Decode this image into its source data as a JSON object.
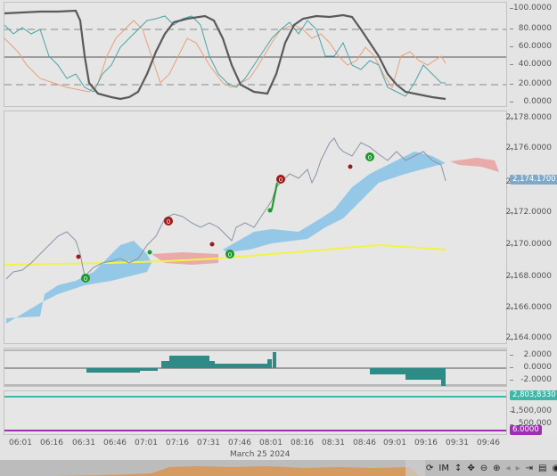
{
  "oscillator_pane": {
    "y_ticks": [
      "100.0000",
      "80.0000",
      "60.0000",
      "40.0000",
      "20.0000",
      "0.0000"
    ]
  },
  "price_pane": {
    "y_ticks": [
      "2,178.0000",
      "2,176.0000",
      "2,174.0000",
      "2,172.0000",
      "2,170.0000",
      "2,168.0000",
      "2,166.0000",
      "2,164.0000"
    ],
    "last_price_badge": "2,174.1700",
    "signal_markers": [
      {
        "label": "0",
        "kind": "sell"
      },
      {
        "label": "0",
        "kind": "sell"
      },
      {
        "label": "0",
        "kind": "buy"
      },
      {
        "label": "0",
        "kind": "buy"
      },
      {
        "label": "0",
        "kind": "buy"
      }
    ]
  },
  "histogram_pane": {
    "y_ticks": [
      "2.0000",
      "0.0000",
      "-2.0000"
    ]
  },
  "volume_pane": {
    "y_ticks": [
      "1,500,000",
      "500,000"
    ],
    "top_badge": "2,803,8330",
    "bottom_badge": "6.0000"
  },
  "x_axis": {
    "labels": [
      "06:01",
      "06:16",
      "06:31",
      "06:46",
      "07:01",
      "07:16",
      "07:31",
      "07:46",
      "08:01",
      "08:16",
      "08:31",
      "08:46",
      "09:01",
      "09:16",
      "09:31",
      "09:46"
    ],
    "date": "March 25 2024"
  },
  "toolbar": {
    "im_label": "IM"
  },
  "colors": {
    "cloud_bull": "#8cc4e6",
    "cloud_bear": "#e9a3a3",
    "ma_line": "#f2f24a",
    "hist": "#2e8b86",
    "teal": "#3cb8a8",
    "purple": "#9d2fb0"
  }
}
